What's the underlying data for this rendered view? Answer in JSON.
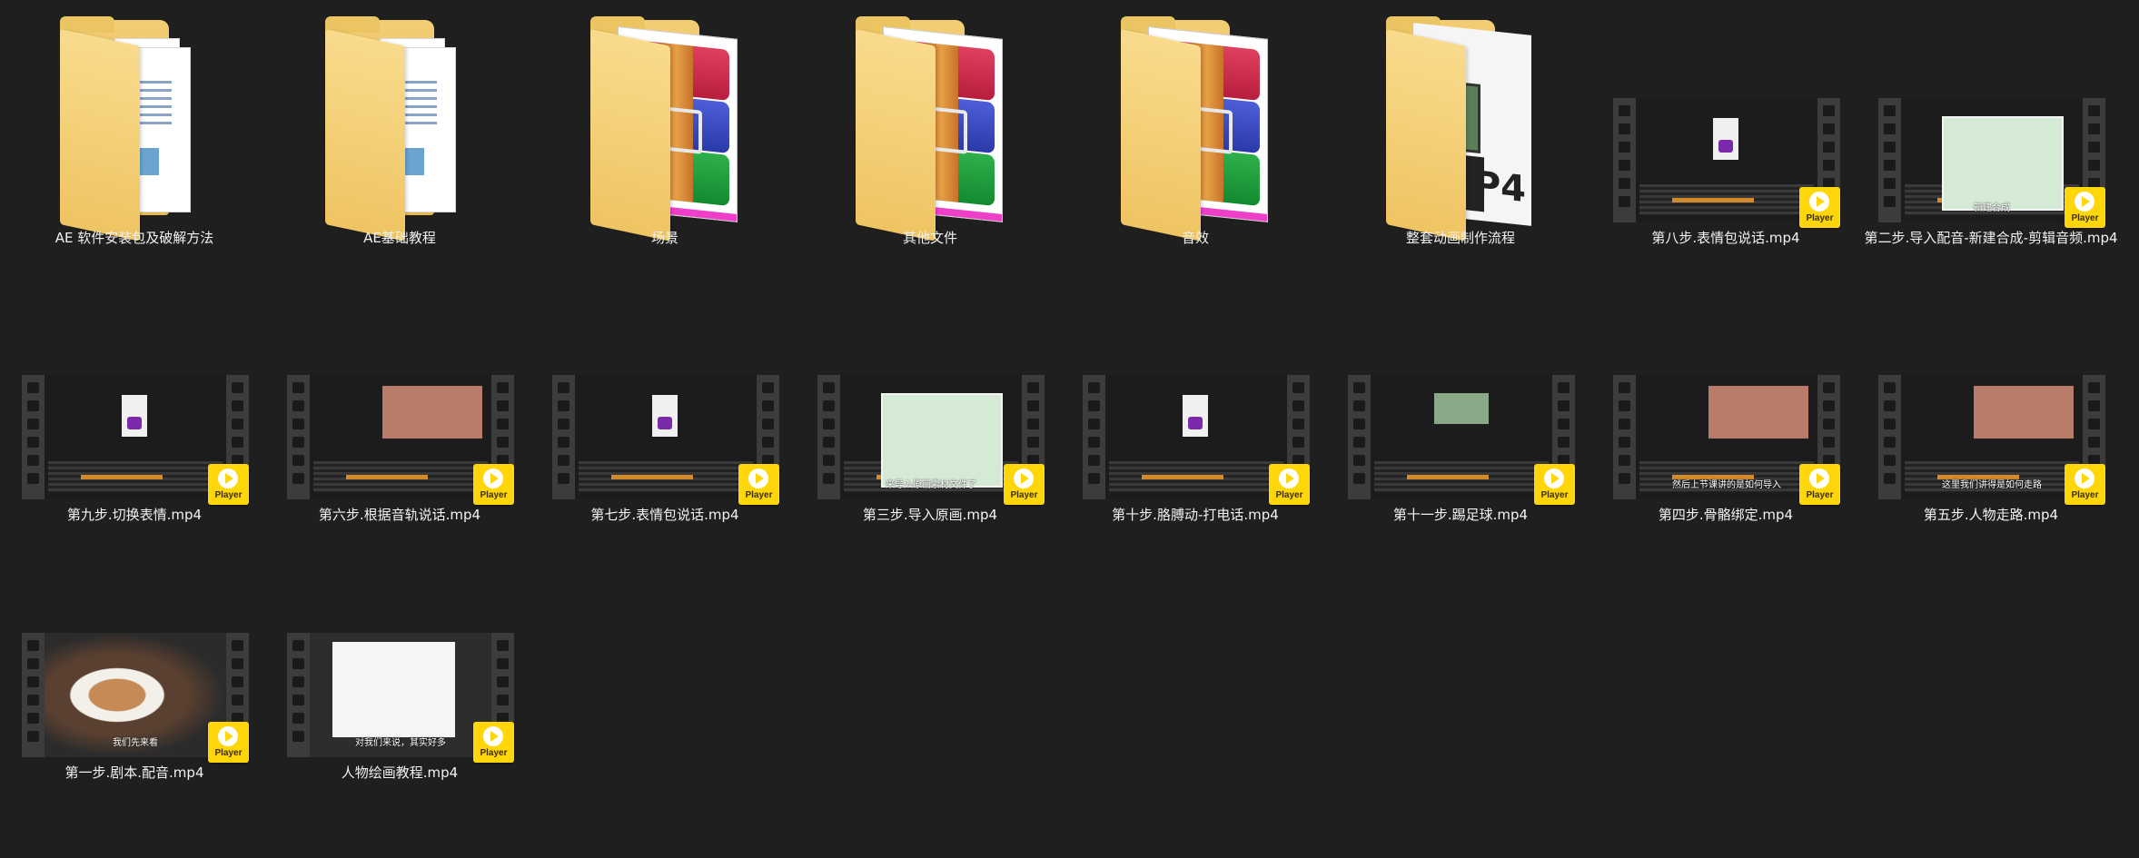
{
  "folders": [
    {
      "name": "AE 软件安装包及破解方法",
      "kind": "docs"
    },
    {
      "name": "AE基础教程",
      "kind": "docs"
    },
    {
      "name": "场景",
      "kind": "rar"
    },
    {
      "name": "其他文件",
      "kind": "rar"
    },
    {
      "name": "音效",
      "kind": "rar"
    },
    {
      "name": "整套动画制作流程",
      "kind": "mp4"
    }
  ],
  "mp4_cover_text": "P4",
  "player_badge_text": "Player",
  "videos": [
    {
      "name": "第八步.表情包说话.mp4",
      "kind": "panda",
      "subtitle": ""
    },
    {
      "name": "第二步.导入配音-新建合成-剪辑音频.mp4",
      "kind": "sheet",
      "subtitle": "新建合成"
    },
    {
      "name": "第九步.切换表情.mp4",
      "kind": "panda",
      "subtitle": ""
    },
    {
      "name": "第六步.根据音轨说话.mp4",
      "kind": "scene",
      "subtitle": ""
    },
    {
      "name": "第七步.表情包说话.mp4",
      "kind": "panda",
      "subtitle": ""
    },
    {
      "name": "第三步.导入原画.mp4",
      "kind": "sheet",
      "subtitle": "来导入原画素材文件了"
    },
    {
      "name": "第十步.胳膊动-打电话.mp4",
      "kind": "panda",
      "subtitle": ""
    },
    {
      "name": "第十一步.踢足球.mp4",
      "kind": "field",
      "subtitle": ""
    },
    {
      "name": "第四步.骨骼绑定.mp4",
      "kind": "scene",
      "subtitle": "然后上节课讲的是如何导入"
    },
    {
      "name": "第五步.人物走路.mp4",
      "kind": "scene",
      "subtitle": "这里我们讲得是如何走路"
    },
    {
      "name": "第一步.剧本.配音.mp4",
      "kind": "dog",
      "subtitle": "我们先来看"
    },
    {
      "name": "人物绘画教程.mp4",
      "kind": "explorer",
      "subtitle": "对我们来说，其实好多"
    }
  ]
}
